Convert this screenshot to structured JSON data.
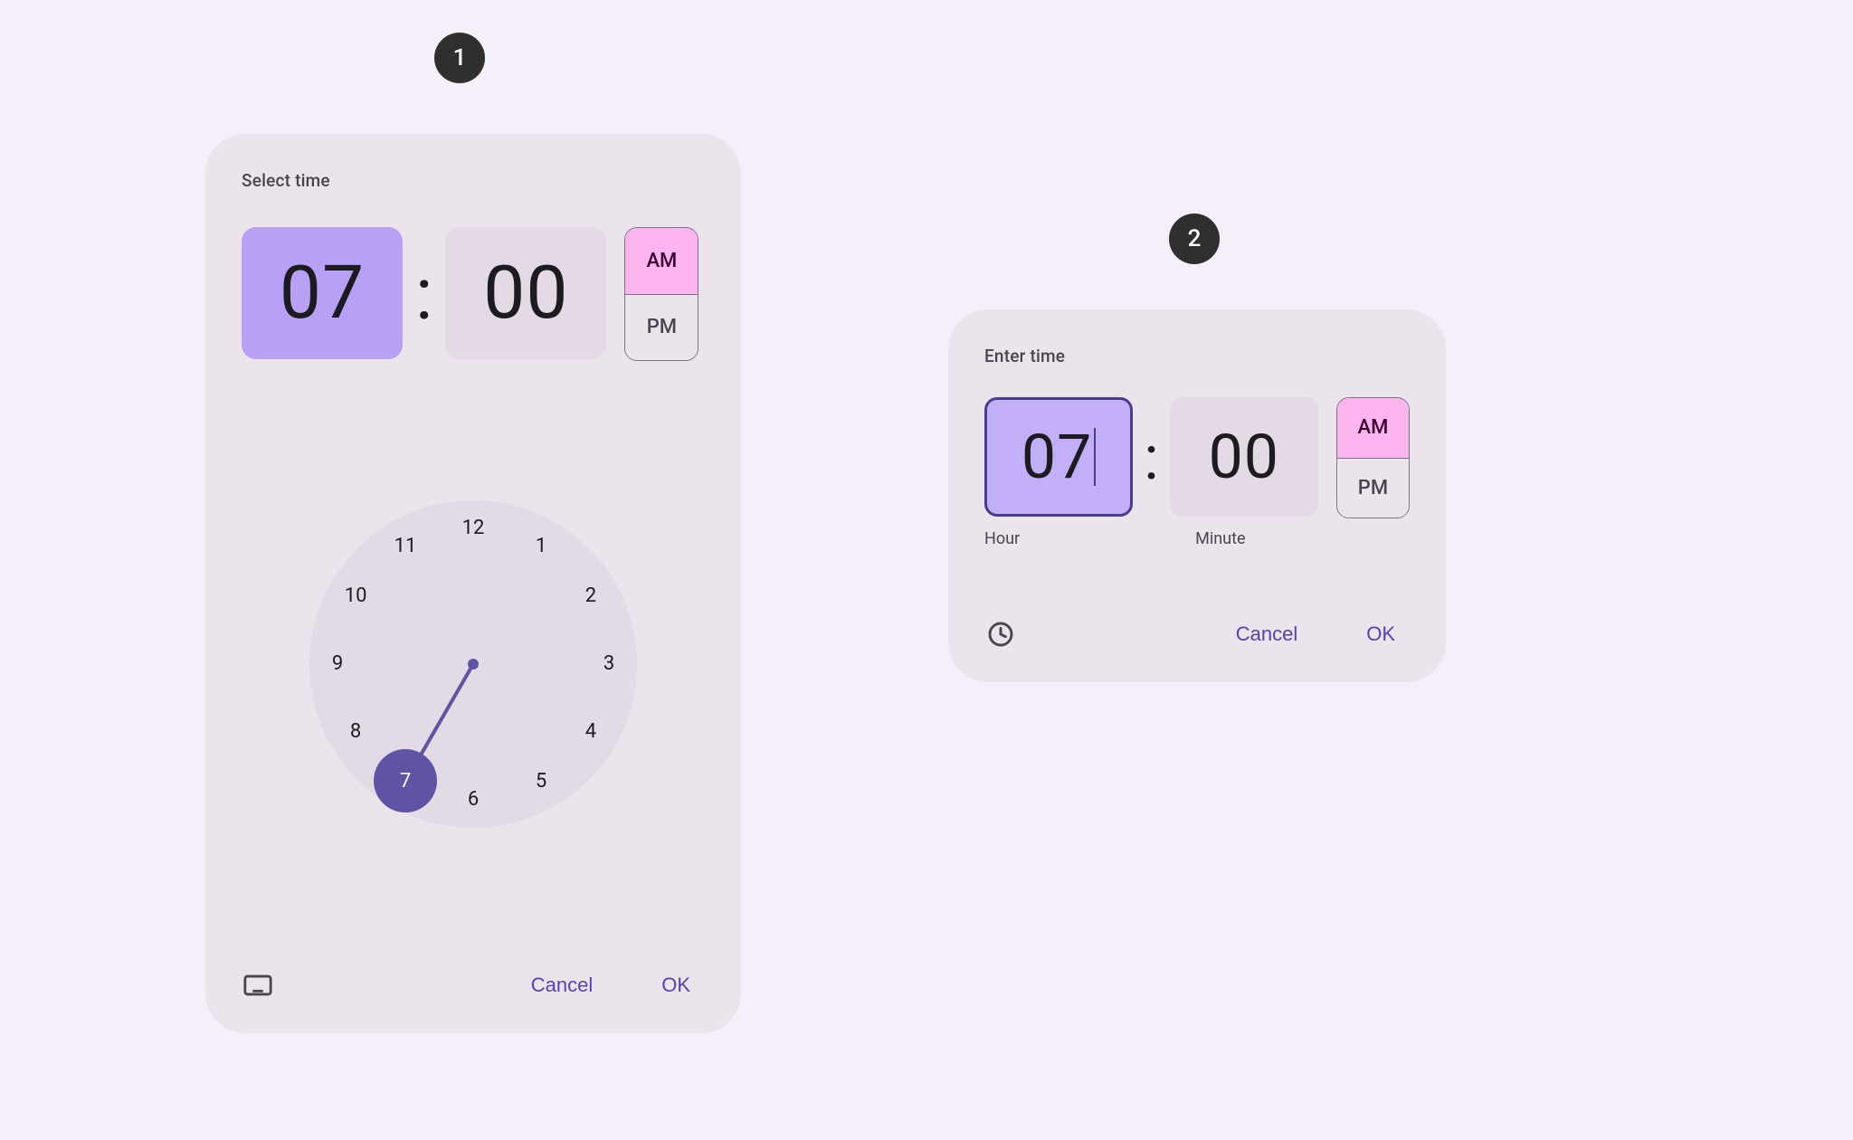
{
  "callouts": {
    "one": "1",
    "two": "2"
  },
  "dial": {
    "title": "Select time",
    "hour_display": "07",
    "minute_display": "00",
    "selected_field": "hour",
    "am_label": "AM",
    "pm_label": "PM",
    "meridiem": "AM",
    "clock_numbers": [
      "12",
      "1",
      "2",
      "3",
      "4",
      "5",
      "6",
      "7",
      "8",
      "9",
      "10",
      "11"
    ],
    "selected_hour": 7,
    "cancel_label": "Cancel",
    "ok_label": "OK"
  },
  "input": {
    "title": "Enter time",
    "hour_value": "07",
    "minute_value": "00",
    "hour_sub": "Hour",
    "minute_sub": "Minute",
    "am_label": "AM",
    "pm_label": "PM",
    "meridiem": "AM",
    "cancel_label": "Cancel",
    "ok_label": "OK"
  },
  "colors": {
    "surface": "#ebe4ec",
    "canvas": "#f5effa",
    "primary": "#5f53a6",
    "am_active_bg": "#fcb5ee",
    "hour_selected_bg_dial": "#b8a0f7",
    "hour_selected_bg_input": "#c3aff7",
    "field_bg": "#e3dae5",
    "text_primary": "#1c1b1f",
    "text_action": "#5443b1"
  }
}
